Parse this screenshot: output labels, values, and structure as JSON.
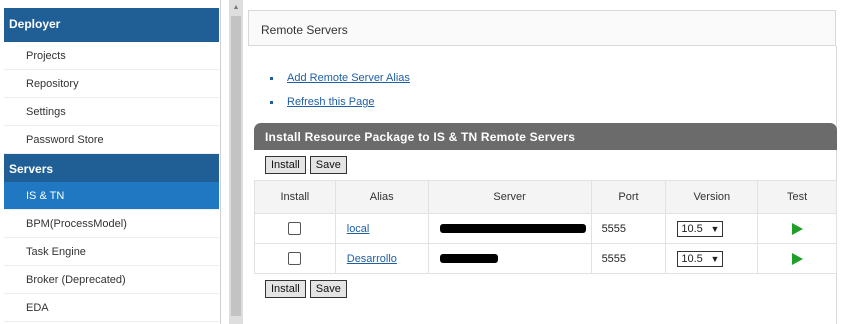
{
  "sidebar": {
    "deployer_header": "Deployer",
    "deployer_items": [
      "Projects",
      "Repository",
      "Settings",
      "Password Store"
    ],
    "servers_header": "Servers",
    "servers_items": [
      "IS & TN",
      "BPM(ProcessModel)",
      "Task Engine",
      "Broker (Deprecated)",
      "EDA"
    ],
    "active_item": "IS & TN"
  },
  "page": {
    "title": "Remote Servers",
    "links": [
      "Add Remote Server Alias",
      "Refresh this Page"
    ]
  },
  "panel": {
    "title": "Install Resource Package to IS & TN Remote Servers",
    "install_label": "Install",
    "save_label": "Save",
    "columns": [
      "Install",
      "Alias",
      "Server",
      "Port",
      "Version",
      "Test"
    ],
    "rows": [
      {
        "alias": "local",
        "port": "5555",
        "version": "10.5"
      },
      {
        "alias": "Desarrollo",
        "port": "5555",
        "version": "10.5"
      }
    ]
  },
  "colors": {
    "header_blue": "#1f5f95",
    "active_blue": "#1f78c1",
    "panel_gray": "#6b6b6b",
    "link_blue": "#1f5fa5",
    "play_green": "#1f9e2a"
  },
  "icons": {
    "test": "play-icon",
    "scroll": "scroll-up-icon"
  }
}
